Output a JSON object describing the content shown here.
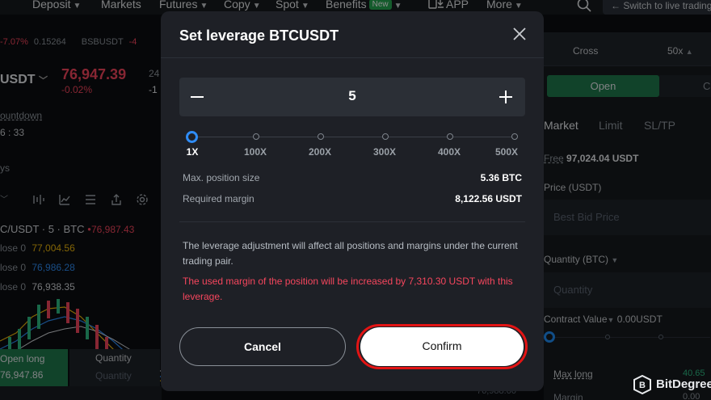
{
  "topnav": {
    "items": [
      {
        "label": "Deposit",
        "chevron": true
      },
      {
        "label": "Markets",
        "chevron": false
      },
      {
        "label": "Futures",
        "chevron": true
      },
      {
        "label": "Copy",
        "chevron": true
      },
      {
        "label": "Spot",
        "chevron": true
      },
      {
        "label": "Benefits",
        "chevron": true,
        "badge": "New"
      },
      {
        "label": "APP",
        "chevron": false
      },
      {
        "label": "More",
        "chevron": true
      }
    ],
    "live_button": "Switch to live trading"
  },
  "left": {
    "ticker_change": "-7.07%",
    "ticker_price": "0.15264",
    "ticker_symbol": "BSBUSDT",
    "ticker_symbol_change": "-4",
    "symbol": "USDT",
    "price": "76,947.39",
    "price_change": "-0.02%",
    "frag_24": "24",
    "frag_minus": "-1",
    "countdown_label": "ountdown",
    "countdown_value": "6 : 33",
    "frag_ys": "ys",
    "pair_line": "C/USDT · 5 · BTC",
    "pair_price": "76,987.43",
    "ma": [
      {
        "label": "lose 0",
        "value": "77,004.56",
        "color": "#f0b90b"
      },
      {
        "label": "lose 0",
        "value": "76,986.28",
        "color": "#2f8cf5"
      },
      {
        "label": "lose 0",
        "value": "76,938.35",
        "color": "#d5d8dc"
      }
    ],
    "open_long_label": "Open long",
    "open_long_price": "76,947.86",
    "quantity_label": "Quantity",
    "quantity_placeholder": "Quantity"
  },
  "right": {
    "margin_mode": "Cross",
    "leverage": "50x",
    "open_tab": "Open",
    "close_tab": "Cl",
    "order_tabs": [
      "Market",
      "Limit",
      "SL/TP"
    ],
    "free_label": "Free",
    "free_value": "97,024.04 USDT",
    "price_label": "Price (USDT)",
    "price_placeholder": "Best Bid Price",
    "qty_label": "Quantity (BTC)",
    "qty_placeholder": "Quantity",
    "contract_label": "Contract Value",
    "contract_value": "0.00USDT",
    "max_long_label": "Max long",
    "max_long_value": "40.65",
    "margin_label": "Margin",
    "margin_value": "0.00"
  },
  "footer_frag": "76,988.00",
  "modal": {
    "title": "Set leverage BTCUSDT",
    "leverage_value": "5",
    "slider_fraction": 0.04,
    "ticks": [
      "1X",
      "100X",
      "200X",
      "300X",
      "400X",
      "500X"
    ],
    "max_position_label": "Max. position size",
    "max_position_value": "5.36 BTC",
    "required_margin_label": "Required margin",
    "required_margin_value": "8,122.56 USDT",
    "note": "The leverage adjustment will affect all positions and margins under the current trading pair.",
    "warning": "The used margin of the position will be increased by 7,310.30 USDT with this leverage.",
    "cancel_label": "Cancel",
    "confirm_label": "Confirm"
  },
  "watermark": {
    "brand": "BitDegree"
  },
  "colors": {
    "accent_blue": "#2f8cf5",
    "danger_red": "#f6465d",
    "highlight_ring": "#e31414",
    "long_green": "#1f7a4d"
  }
}
